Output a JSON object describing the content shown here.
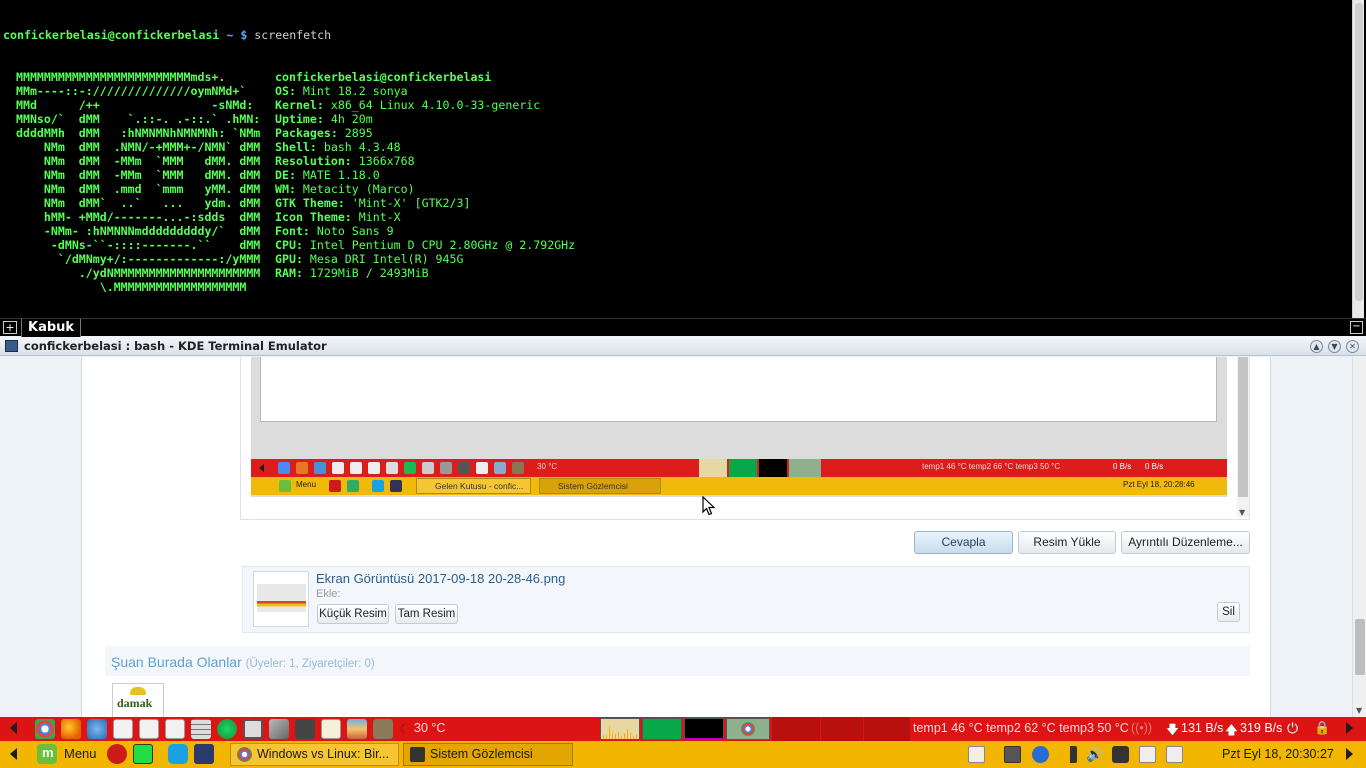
{
  "terminal": {
    "prompt_user": "confickerbelasi@confickerbelasi",
    "prompt_rest": " ~ $ ",
    "command": "screenfetch",
    "art_lines": [
      " MMMMMMMMMMMMMMMMMMMMMMMMMmds+.",
      " MMm----::-://////////////oymNMd+`",
      " MMd      /++                -sNMd:",
      " MMNso/`  dMM    `.::-. .-::.` .hMN:",
      " ddddMMh  dMM   :hNMNMNhNMNMNh: `NMm",
      "     NMm  dMM  .NMN/-+MMM+-/NMN` dMM",
      "     NMm  dMM  -MMm  `MMM   dMM. dMM",
      "     NMm  dMM  -MMm  `MMM   dMM. dMM",
      "     NMm  dMM  .mmd  `mmm   yMM. dMM",
      "     NMm  dMM`  ..`   ...   ydm. dMM",
      "     hMM- +MMd/-------...-:sdds  dMM",
      "     -NMm- :hNMNNNmdddddddddy/`  dMM",
      "      -dMNs-``-::::-------.``    dMM",
      "       `/dMNmy+/:-------------:/yMMM",
      "          ./ydNMMMMMMMMMMMMMMMMMMMMM",
      "             \\.MMMMMMMMMMMMMMMMMMM"
    ],
    "info_header": "confickerbelasi@confickerbelasi",
    "info": [
      {
        "label": "OS:",
        "value": "Mint 18.2 sonya"
      },
      {
        "label": "Kernel:",
        "value": "x86_64 Linux 4.10.0-33-generic"
      },
      {
        "label": "Uptime:",
        "value": "4h 20m"
      },
      {
        "label": "Packages:",
        "value": "2895"
      },
      {
        "label": "Shell:",
        "value": "bash 4.3.48"
      },
      {
        "label": "Resolution:",
        "value": "1366x768"
      },
      {
        "label": "DE:",
        "value": "MATE 1.18.0"
      },
      {
        "label": "WM:",
        "value": "Metacity (Marco)"
      },
      {
        "label": "GTK Theme:",
        "value": "'Mint-X' [GTK2/3]"
      },
      {
        "label": "Icon Theme:",
        "value": "Mint-X"
      },
      {
        "label": "Font:",
        "value": "Noto Sans 9"
      },
      {
        "label": "CPU:",
        "value": "Intel Pentium D CPU 2.80GHz @ 2.792GHz"
      },
      {
        "label": "GPU:",
        "value": "Mesa DRI Intel(R) 945G"
      },
      {
        "label": "RAM:",
        "value": "1729MiB / 2493MiB"
      }
    ],
    "tab_label": "Kabuk",
    "window_title": "confickerbelasi : bash - KDE Terminal Emulator"
  },
  "embedded_screenshot": {
    "temp": "30 °C",
    "sensors": "temp1 46 °C temp2 66 °C temp3 50 °C",
    "net_down": "0 B/s",
    "net_up": "0 B/s",
    "menu": "Menu",
    "task1": "Gelen Kutusu - confic...",
    "task2": "Sistem Gözlemcisi",
    "clock": "Pzt Eyl 18, 20:28:46"
  },
  "post": {
    "reply_button": "Cevapla",
    "upload_button": "Resim Yükle",
    "advanced_button": "Ayrıntılı Düzenleme...",
    "attachment_name": "Ekran Görüntüsü 2017-09-18 20-28-46.png",
    "attachment_add": "Ekle:",
    "thumb_button": "Küçük Resim",
    "full_button": "Tam Resim",
    "delete_button": "Sil",
    "online_title": "Şuan Burada Olanlar",
    "online_counts": "(Üyeler: 1, Ziyaretçiler: 0)",
    "avatar_text": "damak"
  },
  "panel_top": {
    "temp": "30 °C",
    "sensors": "temp1 46 °C temp2 62 °C temp3 50 °C",
    "net_down": "131 B/s",
    "net_up": "319 B/s"
  },
  "panel_bottom": {
    "menu": "Menu",
    "task1": "Windows vs Linux: Bir...",
    "task2": "Sistem Gözlemcisi",
    "clock": "Pzt Eyl 18, 20:30:27"
  },
  "colors": {
    "panel_red": "#dc1414",
    "panel_yellow": "#f2b600",
    "terminal_green": "#55ff55"
  }
}
